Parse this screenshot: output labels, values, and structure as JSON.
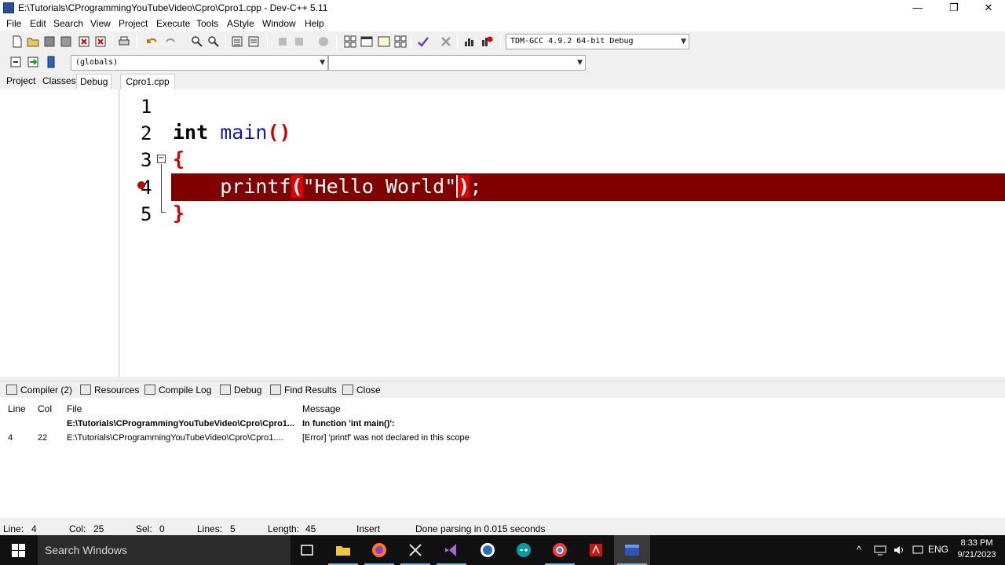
{
  "window": {
    "title": "E:\\Tutorials\\CProgrammingYouTubeVideo\\Cpro\\Cpro1.cpp - Dev-C++ 5.11",
    "minimize_glyph": "—",
    "maximize_glyph": "❐",
    "close_glyph": "✕"
  },
  "menu": [
    "File",
    "Edit",
    "Search",
    "View",
    "Project",
    "Execute",
    "Tools",
    "AStyle",
    "Window",
    "Help"
  ],
  "toolbar": {
    "compiler_select": "TDM-GCC 4.9.2 64-bit Debug",
    "globals_select": "(globals)",
    "members_select": ""
  },
  "left_tabs": [
    "Project",
    "Classes",
    "Debug"
  ],
  "editor": {
    "tab": "Cpro1.cpp",
    "line_numbers": [
      "1",
      "2",
      "3",
      "4",
      "5"
    ],
    "lines": {
      "l2_kw": "int",
      "l2_fn": "main",
      "l2_paren": "()",
      "l3": "{",
      "l4_indent": "    ",
      "l4_call": "printf",
      "l4_open": "(",
      "l4_str": "\"Hello World\"",
      "l4_close": ")",
      "l4_semi": ";",
      "l5": "}"
    },
    "error_line": 4,
    "colors": {
      "error_bg": "#800000",
      "keyword": "#000000",
      "function": "#1a1a8f",
      "brace": "#d10000"
    }
  },
  "bottom_tabs": [
    "Compiler (2)",
    "Resources",
    "Compile Log",
    "Debug",
    "Find Results",
    "Close"
  ],
  "messages": {
    "headers": {
      "line": "Line",
      "col": "Col",
      "file": "File",
      "message": "Message"
    },
    "rows": [
      {
        "line": "",
        "col": "",
        "file": "E:\\Tutorials\\CProgrammingYouTubeVideo\\Cpro\\Cpro1...",
        "message": "In function 'int main()':"
      },
      {
        "line": "4",
        "col": "22",
        "file": "E:\\Tutorials\\CProgrammingYouTubeVideo\\Cpro\\Cpro1....",
        "message": "[Error] 'printf' was not declared in this scope"
      }
    ]
  },
  "status": {
    "line_label": "Line:",
    "line": "4",
    "col_label": "Col:",
    "col": "25",
    "sel_label": "Sel:",
    "sel": "0",
    "lines_label": "Lines:",
    "lines": "5",
    "length_label": "Length:",
    "length": "45",
    "mode": "Insert",
    "message": "Done parsing in 0.015 seconds"
  },
  "taskbar": {
    "search_placeholder": "Search Windows",
    "apps": [
      "task-view",
      "file-explorer",
      "firefox",
      "snipping-tool",
      "visual-studio",
      "word",
      "arduino",
      "chrome",
      "acrobat",
      "devcpp"
    ],
    "language": "ENG",
    "time": "8:33 PM",
    "date": "9/21/2023"
  }
}
